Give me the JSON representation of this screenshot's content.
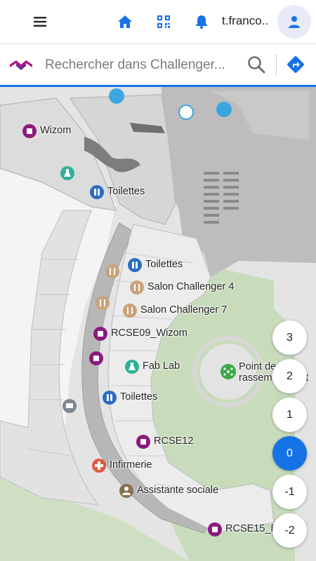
{
  "header": {
    "username": "t.franco..",
    "icons": [
      "menu-icon",
      "home-icon",
      "qr-code-icon",
      "bell-icon",
      "user-icon"
    ]
  },
  "search": {
    "placeholder": "Rechercher dans Challenger...",
    "value": ""
  },
  "map": {
    "pois": [
      {
        "label": "Wizom",
        "icon": "room-icon",
        "color": "#8b1a7e"
      },
      {
        "label": "Toilettes",
        "icon": "toilet-icon",
        "color": "#2c6cc4"
      },
      {
        "label": "Toilettes",
        "icon": "toilet-icon",
        "color": "#2c6cc4"
      },
      {
        "label": "Salon Challenger 4",
        "icon": "restaurant-icon",
        "color": "#c9a27a"
      },
      {
        "label": "Salon Challenger 7",
        "icon": "restaurant-icon",
        "color": "#c9a27a"
      },
      {
        "label": "RCSE09_Wizom",
        "icon": "room-icon",
        "color": "#8b1a7e"
      },
      {
        "label": "Fab Lab",
        "icon": "flask-icon",
        "color": "#2bb39a"
      },
      {
        "label": "Toilettes",
        "icon": "toilet-icon",
        "color": "#2c6cc4"
      },
      {
        "label": "RCSE12",
        "icon": "room-icon",
        "color": "#8b1a7e"
      },
      {
        "label": "Infirmerie",
        "icon": "medical-cross-icon",
        "color": "#e05a3e"
      },
      {
        "label": "Assistante sociale",
        "icon": "person-icon",
        "color": "#8a7250"
      },
      {
        "label": "RCSE15_B",
        "icon": "room-icon",
        "color": "#8b1a7e"
      },
      {
        "label": "Point de rassemblement",
        "icon": "assembly-point-icon",
        "color": "#3aa84a"
      }
    ]
  },
  "floors": [
    "3",
    "2",
    "1",
    "0",
    "-1",
    "-2"
  ],
  "active_floor": "0",
  "colors": {
    "accent": "#1673e6",
    "room": "#8b1a7e",
    "green_area": "#c8dcbc"
  }
}
